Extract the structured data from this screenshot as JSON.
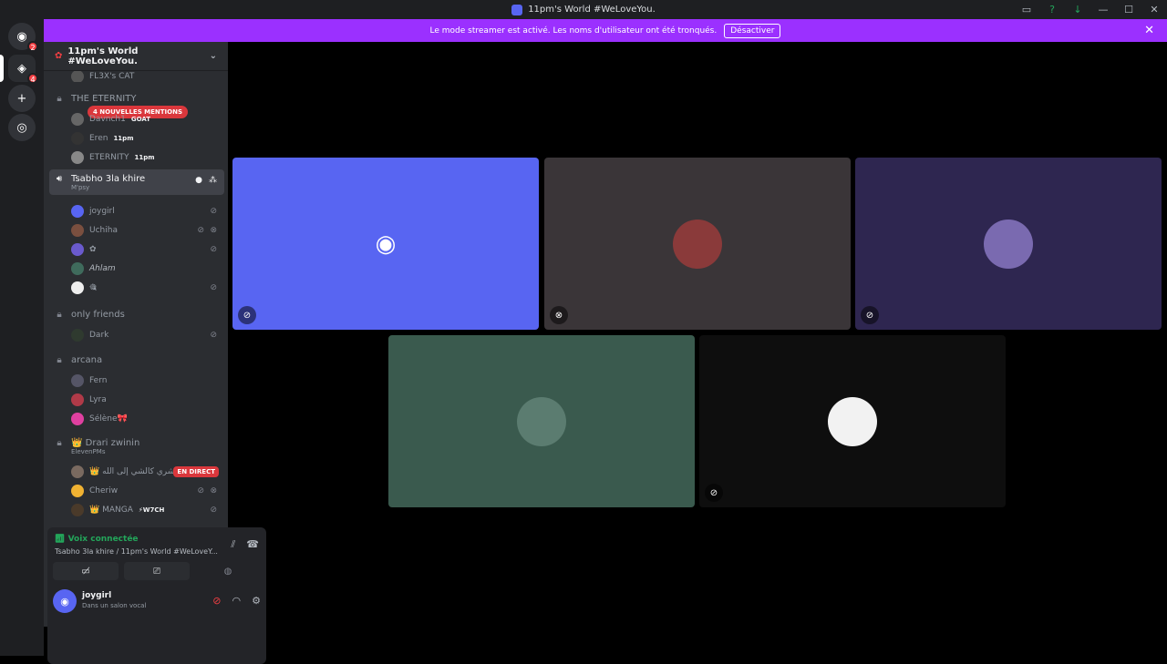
{
  "titlebar": {
    "title": "11pm's World #WeLoveYou.",
    "icons": [
      "screen-share-icon",
      "help-icon",
      "download-icon",
      "minimize-icon",
      "maximize-icon",
      "close-icon"
    ]
  },
  "servers": {
    "home_badge": "2",
    "active_badge_top": "4",
    "active_badge_bottom": "4"
  },
  "banner": {
    "text": "Le mode streamer est activé. Les noms d'utilisateur ont été tronqués.",
    "button": "Désactiver"
  },
  "guild": {
    "name": "11pm's World #WeLoveYou."
  },
  "mention_pill": "4 NOUVELLES MENTIONS",
  "channels": {
    "partial_top": "FL3X's CAT",
    "eternity": {
      "name": "THE ETERNITY",
      "users": [
        {
          "name": "Davnch1",
          "tag": "GOAT"
        },
        {
          "name": "Eren",
          "tag": "11pm"
        },
        {
          "name": "ETERNITY",
          "tag": "11pm"
        }
      ]
    },
    "selected": {
      "name": "Tsabho 3la khire",
      "sub": "M'psy",
      "users": [
        {
          "name": "joygirl"
        },
        {
          "name": "Uchiha"
        },
        {
          "name": "✿"
        },
        {
          "name": "Ahlam"
        },
        {
          "name": "🎕"
        }
      ]
    },
    "only_friends": {
      "name": "only friends",
      "users": [
        {
          "name": "Dark"
        }
      ]
    },
    "arcana": {
      "name": "arcana",
      "users": [
        {
          "name": "Fern"
        },
        {
          "name": "Lyra"
        },
        {
          "name": "Sélène🎀"
        }
      ]
    },
    "drari": {
      "name": "👑 Drari zwinin",
      "sub": "ElevenPMs",
      "live_label": "EN DIRECT",
      "users": [
        {
          "name": "👑 شري كالشي إلى الله"
        },
        {
          "name": "Cheriw"
        },
        {
          "name": "👑 MANGA",
          "tag": "⚡W7CH"
        }
      ]
    }
  },
  "voice": {
    "status": "Voix connectée",
    "location": "Tsabho 3la khire / 11pm's World #WeLoveY..."
  },
  "user_panel": {
    "name": "joygirl",
    "status": "Dans un salon vocal"
  },
  "colors": {
    "blurple": "#5865f2",
    "banner": "#9b30ff",
    "live_red": "#da373c",
    "green": "#23a55a"
  }
}
